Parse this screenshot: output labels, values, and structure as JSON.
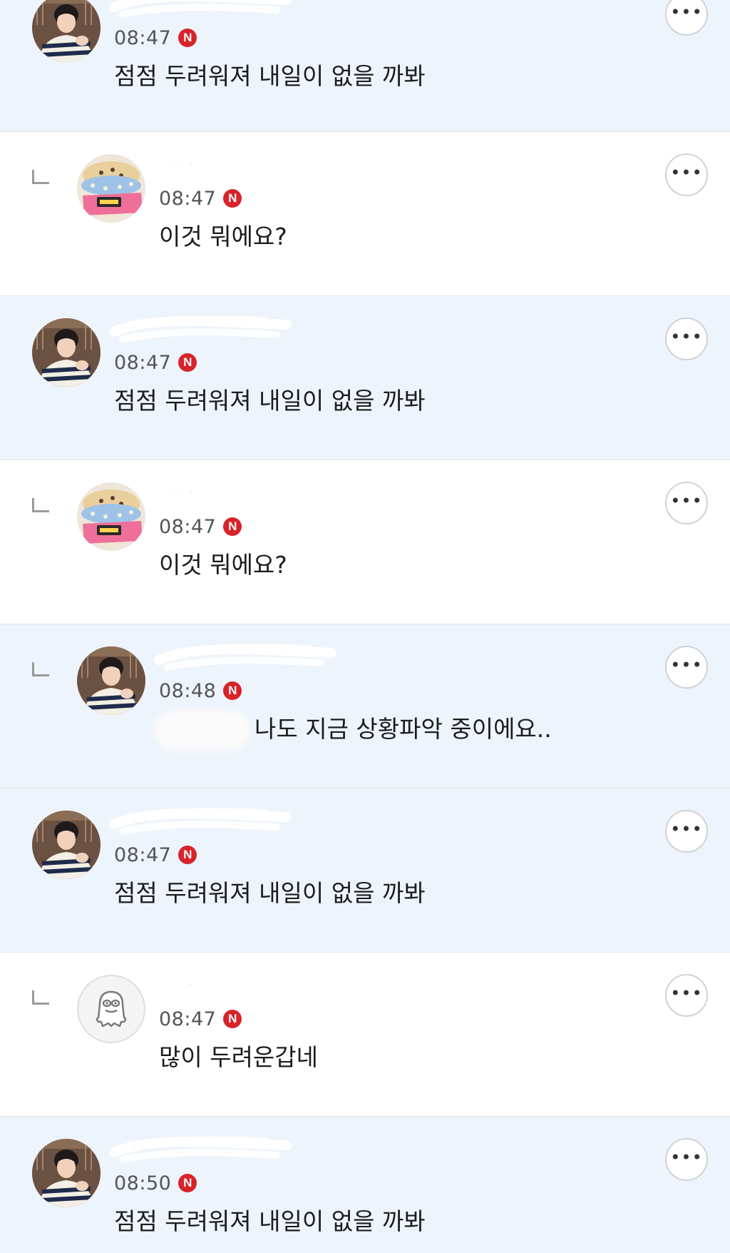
{
  "comments": [
    {
      "author": "· · ·",
      "time": "08:47",
      "badge": "N",
      "text": "점점 두려워져 내일이 없을 까봐",
      "more_label": "•••",
      "avatar": "profile-photo"
    },
    {
      "author": "· · ·",
      "time": "08:47",
      "badge": "N",
      "text": "이것 뭐에요?",
      "more_label": "•••",
      "avatar": "cake-photo"
    },
    {
      "author": "· · ·",
      "time": "08:47",
      "badge": "N",
      "text": "점점 두려워져 내일이 없을 까봐",
      "more_label": "•••",
      "avatar": "profile-photo"
    },
    {
      "author": "· · ·",
      "time": "08:47",
      "badge": "N",
      "text": "이것 뭐에요?",
      "more_label": "•••",
      "avatar": "cake-photo"
    },
    {
      "author": "· · ·",
      "time": "08:48",
      "badge": "N",
      "text": "나도 지금 상황파악 중이에요..",
      "more_label": "•••",
      "avatar": "profile-photo"
    },
    {
      "author": "· · ·",
      "time": "08:47",
      "badge": "N",
      "text": "점점 두려워져 내일이 없을 까봐",
      "more_label": "•••",
      "avatar": "profile-photo"
    },
    {
      "author": "· · ·",
      "time": "08:47",
      "badge": "N",
      "text": "많이 두려운갑네",
      "more_label": "•••",
      "avatar": "default-character"
    },
    {
      "author": "· · ·",
      "time": "08:50",
      "badge": "N",
      "text": "점점 두려워져 내일이 없을 까봐",
      "more_label": "•••",
      "avatar": "profile-photo"
    }
  ]
}
